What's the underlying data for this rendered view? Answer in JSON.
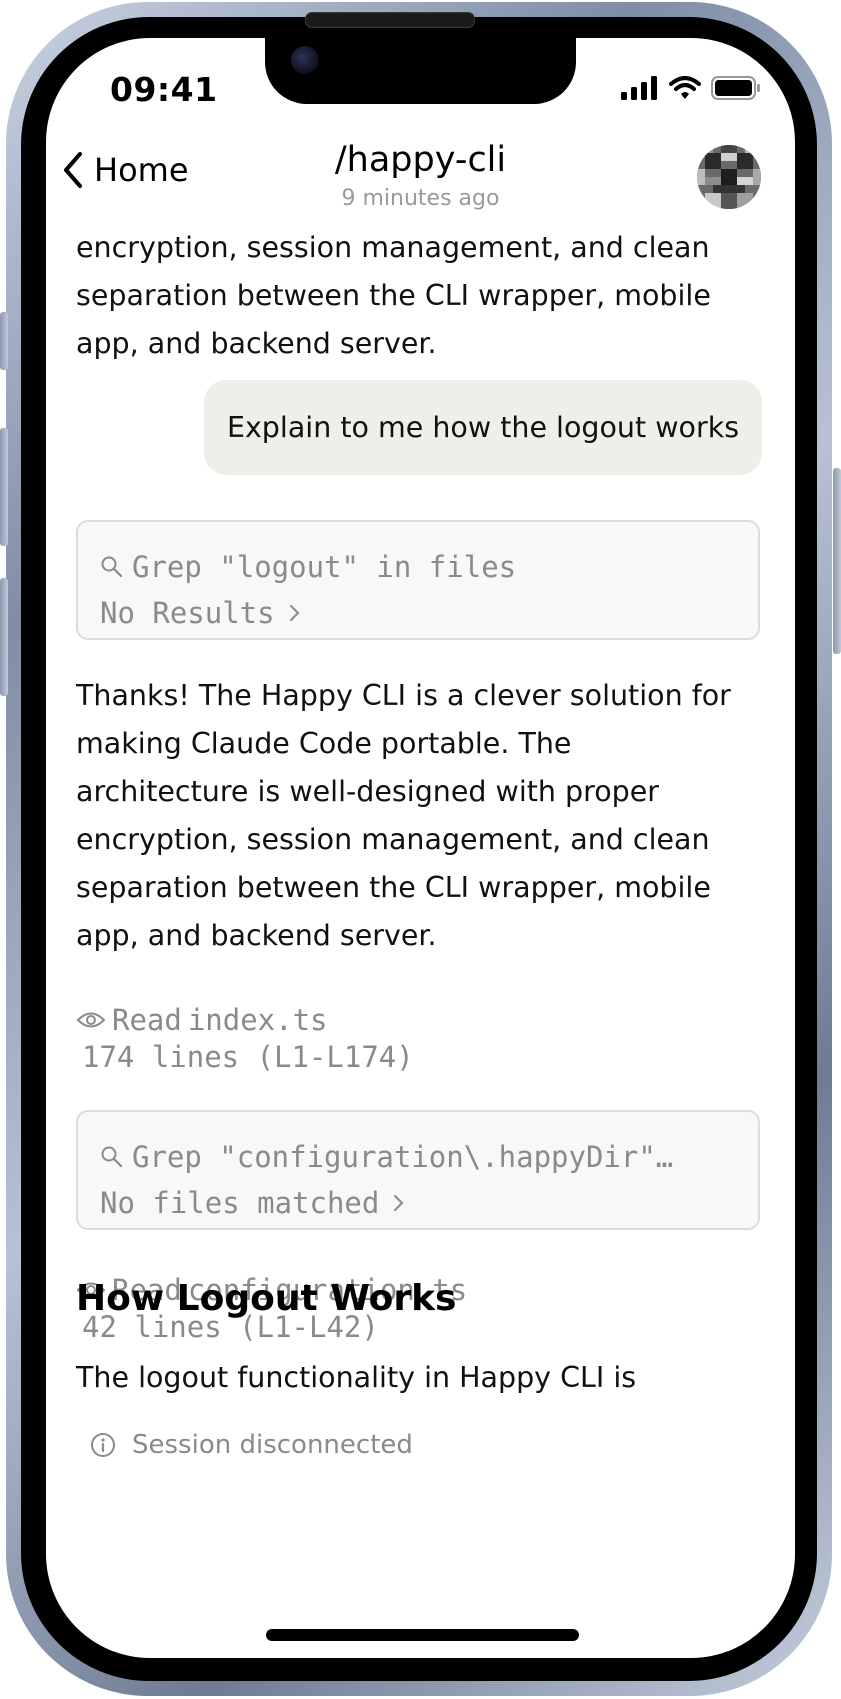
{
  "status_bar": {
    "time": "09:41"
  },
  "header": {
    "back_label": "Home",
    "title": "/happy-cli",
    "subtitle": "9 minutes ago"
  },
  "messages": {
    "intro_para_lines": [
      "encryption, session management, and clean",
      "separation between the CLI wrapper, mobile",
      "app, and backend server."
    ],
    "user_message": "Explain to me how the logout works",
    "tool1": {
      "command": "Grep \"logout\" in files",
      "result": "No Results"
    },
    "assistant_para_lines": [
      "Thanks! The Happy CLI is a clever solution for",
      "making Claude Code portable. The",
      "architecture is well-designed with proper",
      "encryption, session management, and clean",
      "separation between the CLI wrapper, mobile",
      "app, and backend server."
    ],
    "read1": {
      "label": "Read",
      "file": "index.ts",
      "detail": "174 lines (L1-L174)"
    },
    "tool2": {
      "command": "Grep \"configuration\\.happyDir\"…",
      "result": "No files matched"
    },
    "read2": {
      "label": "Read",
      "file": "configuration.ts",
      "detail": "42 lines (L1-L42)"
    },
    "heading": "How Logout Works",
    "logout_para": "The logout functionality in Happy CLI is"
  },
  "footer": {
    "session_status": "Session disconnected"
  },
  "icons": {
    "back": "chevron-left-icon",
    "search": "search-icon",
    "eye": "eye-icon",
    "info": "info-icon",
    "chevron": "chevron-right-icon"
  },
  "colors": {
    "bubble": "#f0eee8",
    "muted": "#8a8a8a",
    "card_bg": "#f8f8f8",
    "card_border": "#dcdcdc"
  }
}
